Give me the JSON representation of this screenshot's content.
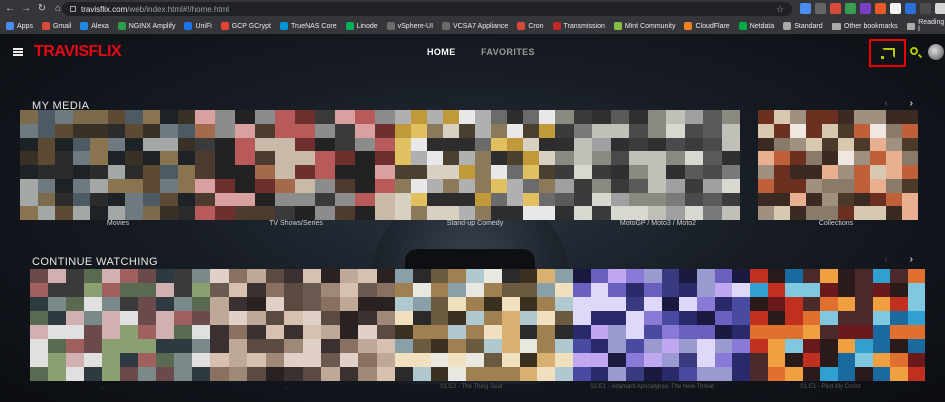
{
  "browser": {
    "url_host": "travisflix.com",
    "url_path": "/web/index.html#!/home.html",
    "bookmarks": [
      "Apps",
      "Gmail",
      "Alexa",
      "NGINX Amplify",
      "UniFi",
      "GCP GCrypt",
      "TrueNAS Core",
      "Linode",
      "vSphere-UI",
      "VCSA7 Appliance",
      "Cron",
      "Transmission",
      "Mint Community",
      "CloudFlare",
      "Netdata",
      "Standard"
    ],
    "other_bookmarks": "Other bookmarks",
    "reading_list": "Reading l"
  },
  "app": {
    "logo": "TRAVISFLIX",
    "nav": {
      "home": "HOME",
      "favorites": "FAVORITES"
    },
    "accent_color": "#b6c800",
    "brand_color": "#e50914",
    "highlight_box_color": "#e00000"
  },
  "my_media": {
    "title": "MY MEDIA",
    "items": [
      {
        "label": "Movies"
      },
      {
        "label": "TV Shows/Series"
      },
      {
        "label": "Stand-up Comedy"
      },
      {
        "label": "MotoGP / Moto3 / Moto2"
      },
      {
        "label": "Collections"
      }
    ]
  },
  "continue_watching": {
    "title": "CONTINUE WATCHING",
    "captions": [
      "...",
      "...",
      "S1:E2 - The Thing Seat",
      "S2:E1 - Adamant Apocalypse: The New Threat",
      "S1:E1 - Pilot My Christ"
    ]
  },
  "arrows": {
    "prev": "‹",
    "next": "›"
  }
}
